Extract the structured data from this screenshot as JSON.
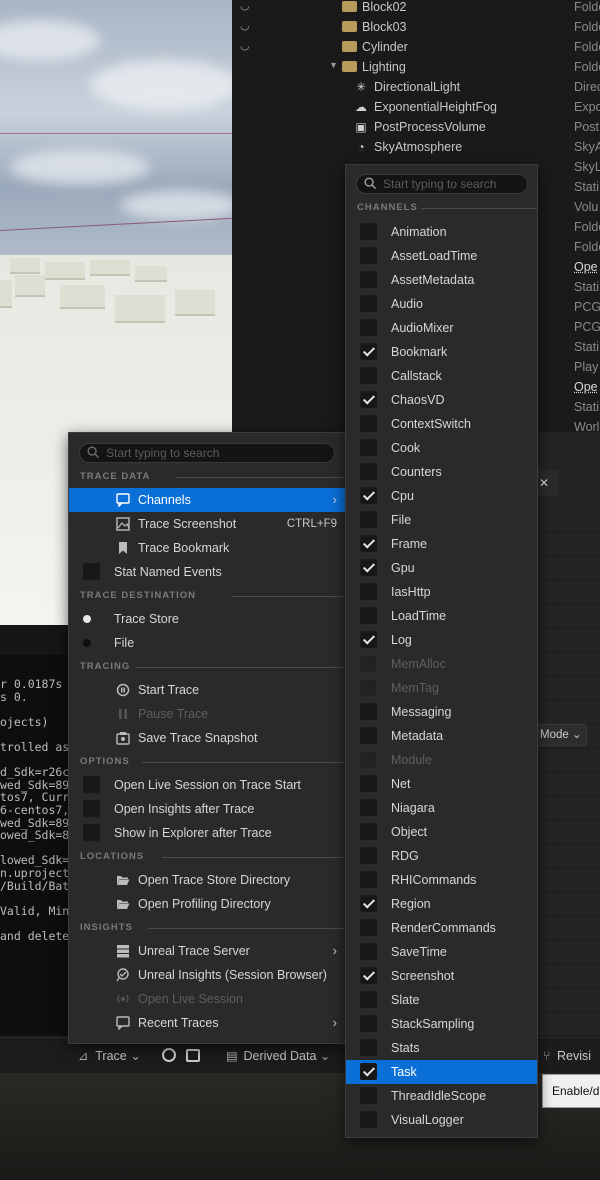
{
  "outliner": {
    "rows": [
      {
        "label": "Block02",
        "type": "Folde",
        "kind": "folder",
        "eye": true
      },
      {
        "label": "Block03",
        "type": "Folde",
        "kind": "folder",
        "eye": true
      },
      {
        "label": "Cylinder",
        "type": "Folde",
        "kind": "folder",
        "eye": true
      },
      {
        "label": "Lighting",
        "type": "Folde",
        "kind": "folder-open",
        "eye": false
      },
      {
        "label": "DirectionalLight",
        "type": "Direc",
        "kind": "sun",
        "eye": false
      },
      {
        "label": "ExponentialHeightFog",
        "type": "Expo",
        "kind": "fog",
        "eye": false
      },
      {
        "label": "PostProcessVolume",
        "type": "Post",
        "kind": "box",
        "eye": false
      },
      {
        "label": "SkyAtmosphere",
        "type": "SkyA",
        "kind": "sky",
        "eye": false
      }
    ],
    "right_types": [
      "SkyL",
      "Stati",
      "Volu",
      "Folde",
      "Folde",
      "Ope",
      "Stati",
      "PCGI",
      "PCGI",
      "Stati",
      "Play",
      "Ope",
      "Stati",
      "Worl"
    ]
  },
  "output_log": {
    "lines": [
      "r 0.0187s",
      "s 0.",
      "",
      "ojects)",
      "",
      "trolled ass",
      "",
      "d_Sdk=r26c",
      "wed_Sdk=899",
      "tos7, Curre",
      "6-centos7,",
      "wed_Sdk=899",
      "owed_Sdk=89",
      "",
      "lowed_Sdk=1",
      "n.uproject",
      "/Build/Bat",
      "",
      "Valid, Min/",
      "",
      "and delete"
    ]
  },
  "right_panel": {
    "mode_label": "Mode",
    "close_glyph": "✕"
  },
  "status_bar": {
    "trace_label": "Trace",
    "derived_data_label": "Derived Data",
    "revision_label": "Revisi",
    "tooltip": "Enable/d"
  },
  "trace_menu": {
    "search_placeholder": "Start typing to search",
    "sections": {
      "trace_data": "TRACE DATA",
      "trace_destination": "TRACE DESTINATION",
      "tracing": "TRACING",
      "options": "OPTIONS",
      "locations": "LOCATIONS",
      "insights": "INSIGHTS"
    },
    "items": {
      "channels": "Channels",
      "trace_screenshot": "Trace Screenshot",
      "trace_screenshot_shortcut": "CTRL+F9",
      "trace_bookmark": "Trace Bookmark",
      "stat_named_events": "Stat Named Events",
      "trace_store": "Trace Store",
      "file": "File",
      "start_trace": "Start Trace",
      "pause_trace": "Pause Trace",
      "save_trace_snapshot": "Save Trace Snapshot",
      "open_live_session": "Open Live Session on Trace Start",
      "open_insights_after": "Open Insights after Trace",
      "show_in_explorer": "Show in Explorer after Trace",
      "open_trace_store_dir": "Open Trace Store Directory",
      "open_profiling_dir": "Open Profiling Directory",
      "unreal_trace_server": "Unreal Trace Server",
      "unreal_insights": "Unreal Insights (Session Browser)",
      "open_live_session_item": "Open Live Session",
      "recent_traces": "Recent Traces"
    },
    "state": {
      "stat_named_events": false,
      "destination": "Trace Store",
      "open_live_session": false,
      "open_insights_after": false,
      "show_in_explorer": false
    }
  },
  "channels_menu": {
    "search_placeholder": "Start typing to search",
    "section": "CHANNELS",
    "channels": [
      {
        "name": "Animation",
        "checked": false,
        "enabled": true
      },
      {
        "name": "AssetLoadTime",
        "checked": false,
        "enabled": true
      },
      {
        "name": "AssetMetadata",
        "checked": false,
        "enabled": true
      },
      {
        "name": "Audio",
        "checked": false,
        "enabled": true
      },
      {
        "name": "AudioMixer",
        "checked": false,
        "enabled": true
      },
      {
        "name": "Bookmark",
        "checked": true,
        "enabled": true
      },
      {
        "name": "Callstack",
        "checked": false,
        "enabled": true
      },
      {
        "name": "ChaosVD",
        "checked": true,
        "enabled": true
      },
      {
        "name": "ContextSwitch",
        "checked": false,
        "enabled": true
      },
      {
        "name": "Cook",
        "checked": false,
        "enabled": true
      },
      {
        "name": "Counters",
        "checked": false,
        "enabled": true
      },
      {
        "name": "Cpu",
        "checked": true,
        "enabled": true
      },
      {
        "name": "File",
        "checked": false,
        "enabled": true
      },
      {
        "name": "Frame",
        "checked": true,
        "enabled": true
      },
      {
        "name": "Gpu",
        "checked": true,
        "enabled": true
      },
      {
        "name": "IasHttp",
        "checked": false,
        "enabled": true
      },
      {
        "name": "LoadTime",
        "checked": false,
        "enabled": true
      },
      {
        "name": "Log",
        "checked": true,
        "enabled": true
      },
      {
        "name": "MemAlloc",
        "checked": false,
        "enabled": false
      },
      {
        "name": "MemTag",
        "checked": false,
        "enabled": false
      },
      {
        "name": "Messaging",
        "checked": false,
        "enabled": true
      },
      {
        "name": "Metadata",
        "checked": false,
        "enabled": true
      },
      {
        "name": "Module",
        "checked": false,
        "enabled": false
      },
      {
        "name": "Net",
        "checked": false,
        "enabled": true
      },
      {
        "name": "Niagara",
        "checked": false,
        "enabled": true
      },
      {
        "name": "Object",
        "checked": false,
        "enabled": true
      },
      {
        "name": "RDG",
        "checked": false,
        "enabled": true
      },
      {
        "name": "RHICommands",
        "checked": false,
        "enabled": true
      },
      {
        "name": "Region",
        "checked": true,
        "enabled": true
      },
      {
        "name": "RenderCommands",
        "checked": false,
        "enabled": true
      },
      {
        "name": "SaveTime",
        "checked": false,
        "enabled": true
      },
      {
        "name": "Screenshot",
        "checked": true,
        "enabled": true
      },
      {
        "name": "Slate",
        "checked": false,
        "enabled": true
      },
      {
        "name": "StackSampling",
        "checked": false,
        "enabled": true
      },
      {
        "name": "Stats",
        "checked": false,
        "enabled": true
      },
      {
        "name": "Task",
        "checked": true,
        "enabled": true,
        "highlighted": true
      },
      {
        "name": "ThreadIdleScope",
        "checked": false,
        "enabled": true
      },
      {
        "name": "VisualLogger",
        "checked": false,
        "enabled": true
      }
    ]
  },
  "colors": {
    "selection": "#0b6fd8",
    "menu_bg": "#2a2a2a",
    "folder": "#b89a5a"
  }
}
